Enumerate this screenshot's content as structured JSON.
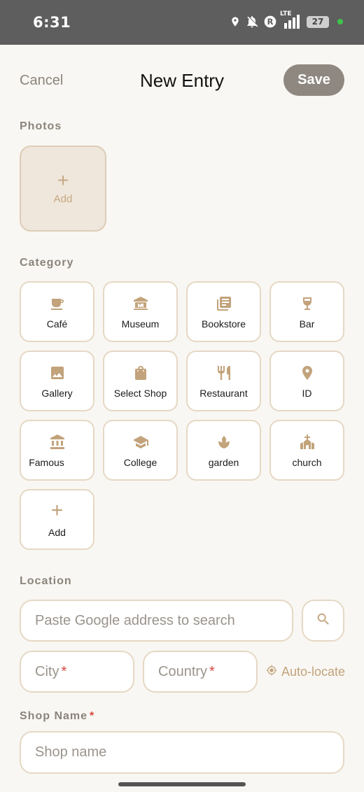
{
  "status_bar": {
    "time": "6:31",
    "network": "LTE",
    "battery": "27",
    "icons": [
      "location-icon",
      "bell-off-icon",
      "r-badge-icon",
      "signal-icon",
      "battery-icon"
    ]
  },
  "header": {
    "cancel_label": "Cancel",
    "title": "New Entry",
    "save_label": "Save"
  },
  "photos": {
    "section_label": "Photos",
    "add_label": "Add",
    "add_symbol": "+"
  },
  "category": {
    "section_label": "Category",
    "items": [
      {
        "label": "Café",
        "icon": "cafe-icon"
      },
      {
        "label": "Museum",
        "icon": "museum-icon"
      },
      {
        "label": "Bookstore",
        "icon": "book-icon"
      },
      {
        "label": "Bar",
        "icon": "wine-glass-icon"
      },
      {
        "label": "Gallery",
        "icon": "image-icon"
      },
      {
        "label": "Select Shop",
        "icon": "shopping-bag-icon"
      },
      {
        "label": "Restaurant",
        "icon": "restaurant-icon"
      },
      {
        "label": "ID",
        "icon": "location-pin-icon"
      },
      {
        "label": "Famous",
        "icon": "bank-icon"
      },
      {
        "label": "College",
        "icon": "graduation-cap-icon"
      },
      {
        "label": "garden",
        "icon": "plant-icon"
      },
      {
        "label": "church",
        "icon": "church-icon"
      }
    ],
    "add_label": "Add",
    "add_symbol": "+"
  },
  "location": {
    "section_label": "Location",
    "search_placeholder": "Paste Google address to search",
    "city_placeholder": "City",
    "country_placeholder": "Country",
    "required_mark": "*",
    "autolocate_label": "Auto-locate"
  },
  "shop": {
    "section_label": "Shop Name",
    "required_mark": "*",
    "name_placeholder": "Shop name"
  },
  "colors": {
    "accent": "#c2a37b",
    "save_button": "#8f8881",
    "border": "#e5d8c4",
    "background": "#f9f7f3",
    "required": "#d9473f"
  }
}
